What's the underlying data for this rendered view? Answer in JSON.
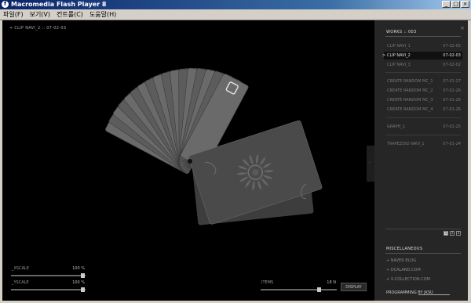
{
  "window": {
    "title": "Macromedia Flash Player 8",
    "icon": "flash-player-icon",
    "controls": [
      "_",
      "□",
      "×"
    ]
  },
  "menu": [
    "파일(F)",
    "보기(V)",
    "컨트롤(C)",
    "도움말(H)"
  ],
  "stage": {
    "clip_label": "+ CLIP NAVI_2 :: 07-02-03",
    "controls": {
      "xscale": {
        "label": "_XSCALE",
        "value": "100 %",
        "fraction": 1.0
      },
      "yscale": {
        "label": "_YSCALE",
        "value": "100 %",
        "fraction": 1.0
      },
      "items": {
        "label": "ITEMS",
        "value": "18 N",
        "fraction": 0.95
      },
      "display_label": "DISPLAY"
    }
  },
  "panel": {
    "works_heading": "WORKS :: 003",
    "close_icon": "×",
    "works": [
      {
        "name": "CLIP NAVI_1",
        "date": "07-02-05",
        "active": false
      },
      {
        "name": "CLIP NAVI_2",
        "date": "07-02-03",
        "active": true
      },
      {
        "name": "CLIP NAVI_3",
        "date": "07-02-02",
        "active": false
      },
      {
        "name": "CREATE RANDOM MC_1",
        "date": "07-01-27",
        "active": false
      },
      {
        "name": "CREATE RANDOM MC_2",
        "date": "07-01-26",
        "active": false
      },
      {
        "name": "CREATE RANDOM MC_3",
        "date": "07-01-26",
        "active": false
      },
      {
        "name": "CREATE RANDOM MC_4",
        "date": "07-01-26",
        "active": false
      },
      {
        "name": "GRAPH_1",
        "date": "07-01-25",
        "active": false
      },
      {
        "name": "TRAPEZOID NAVI_1",
        "date": "07-01-24",
        "active": false
      }
    ],
    "active_marker": ">",
    "pages": [
      "1",
      "2",
      "3"
    ],
    "current_page": "1",
    "misc_heading": "MISCELLANEOUS",
    "misc_links": [
      "+ NAVER BLOG",
      "+ DCALAND.COM",
      "+ X-COLLECTION.COM"
    ],
    "credit": "PROGRAMMING BY JKSU"
  }
}
